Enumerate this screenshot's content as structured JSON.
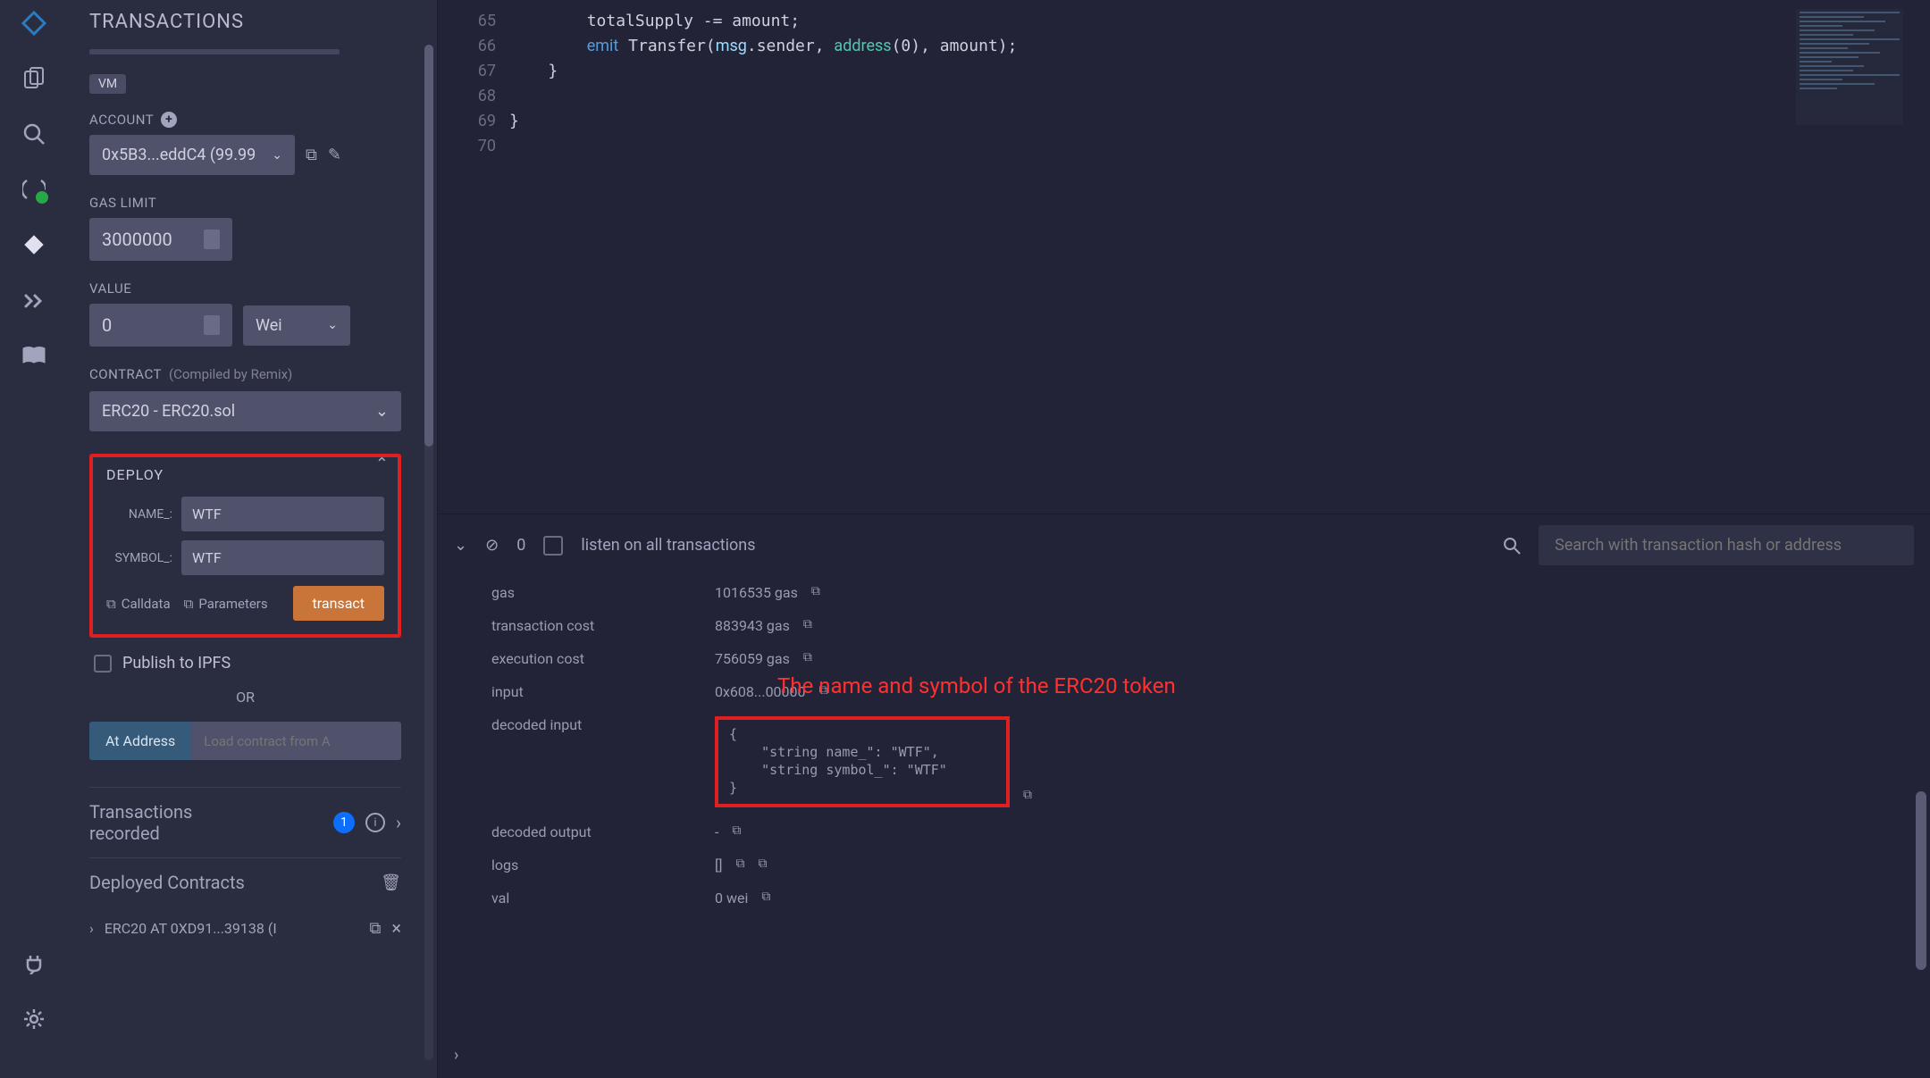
{
  "sidebar": {
    "title": "TRANSACTIONS",
    "vm_badge": "VM",
    "account_label": "ACCOUNT",
    "account_value": "0x5B3...eddC4 (99.99",
    "gas_limit_label": "GAS LIMIT",
    "gas_limit_value": "3000000",
    "value_label": "VALUE",
    "value_value": "0",
    "value_unit": "Wei",
    "contract_label": "CONTRACT",
    "contract_sub": "(Compiled by Remix)",
    "contract_value": "ERC20 - ERC20.sol",
    "deploy": {
      "title": "DEPLOY",
      "name_label": "NAME_:",
      "name_value": "WTF",
      "symbol_label": "SYMBOL_:",
      "symbol_value": "WTF",
      "calldata": "Calldata",
      "parameters": "Parameters",
      "transact": "transact"
    },
    "publish_ipfs": "Publish to IPFS",
    "or": "OR",
    "at_address": "At Address",
    "at_address_placeholder": "Load contract from A",
    "tx_recorded": "Transactions recorded",
    "tx_count": "1",
    "deployed_title": "Deployed Contracts",
    "deployed_item": "ERC20 AT 0XD91...39138 (I"
  },
  "editor": {
    "lines": [
      "65",
      "66",
      "67",
      "68",
      "69",
      "70"
    ]
  },
  "terminal": {
    "pending": "0",
    "listen": "listen on all transactions",
    "search_placeholder": "Search with transaction hash or address",
    "rows": {
      "gas_key": "gas",
      "gas_val": "1016535 gas",
      "txcost_key": "transaction cost",
      "txcost_val": "883943 gas",
      "execost_key": "execution cost",
      "execost_val": "756059 gas",
      "input_key": "input",
      "input_val": "0x608...00000",
      "decin_key": "decoded input",
      "decout_key": "decoded output",
      "decout_val": "-",
      "logs_key": "logs",
      "logs_val": "[]",
      "val_key": "val",
      "val_val": "0 wei"
    },
    "decoded_input_text": "{\n    \"string name_\": \"WTF\",\n    \"string symbol_\": \"WTF\"\n}"
  },
  "annotation": "The name and symbol of the ERC20 token"
}
